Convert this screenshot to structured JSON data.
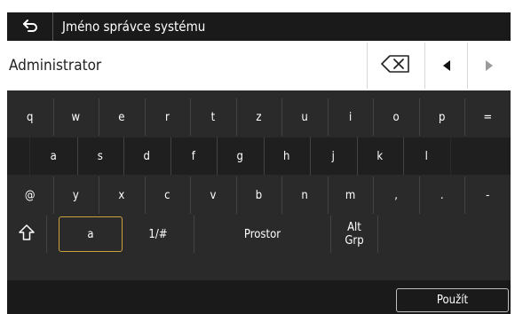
{
  "title": "Jméno správce systému",
  "input": {
    "value": "Administrator"
  },
  "icons": {
    "back": "back-arrow-icon",
    "clear": "backspace-x-icon",
    "cursor_left": "triangle-left-icon",
    "cursor_right": "triangle-right-icon",
    "shift": "shift-up-arrow-icon"
  },
  "keyboard": {
    "row1": [
      "q",
      "w",
      "e",
      "r",
      "t",
      "z",
      "u",
      "i",
      "o",
      "p",
      "="
    ],
    "row2": [
      "a",
      "s",
      "d",
      "f",
      "g",
      "h",
      "j",
      "k",
      "l"
    ],
    "row3": [
      "@",
      "y",
      "x",
      "c",
      "v",
      "b",
      "n",
      "m",
      ",",
      ".",
      "-"
    ],
    "row4": {
      "mode": "a",
      "symbols": "1/#",
      "space": "Prostor",
      "altgr_line1": "Alt",
      "altgr_line2": "Grp"
    }
  },
  "footer": {
    "apply": "Použít"
  },
  "colors": {
    "dark": "#1a1a1a",
    "keyboard_bg": "#2a2a2a",
    "accent_border": "#c9a23a"
  }
}
